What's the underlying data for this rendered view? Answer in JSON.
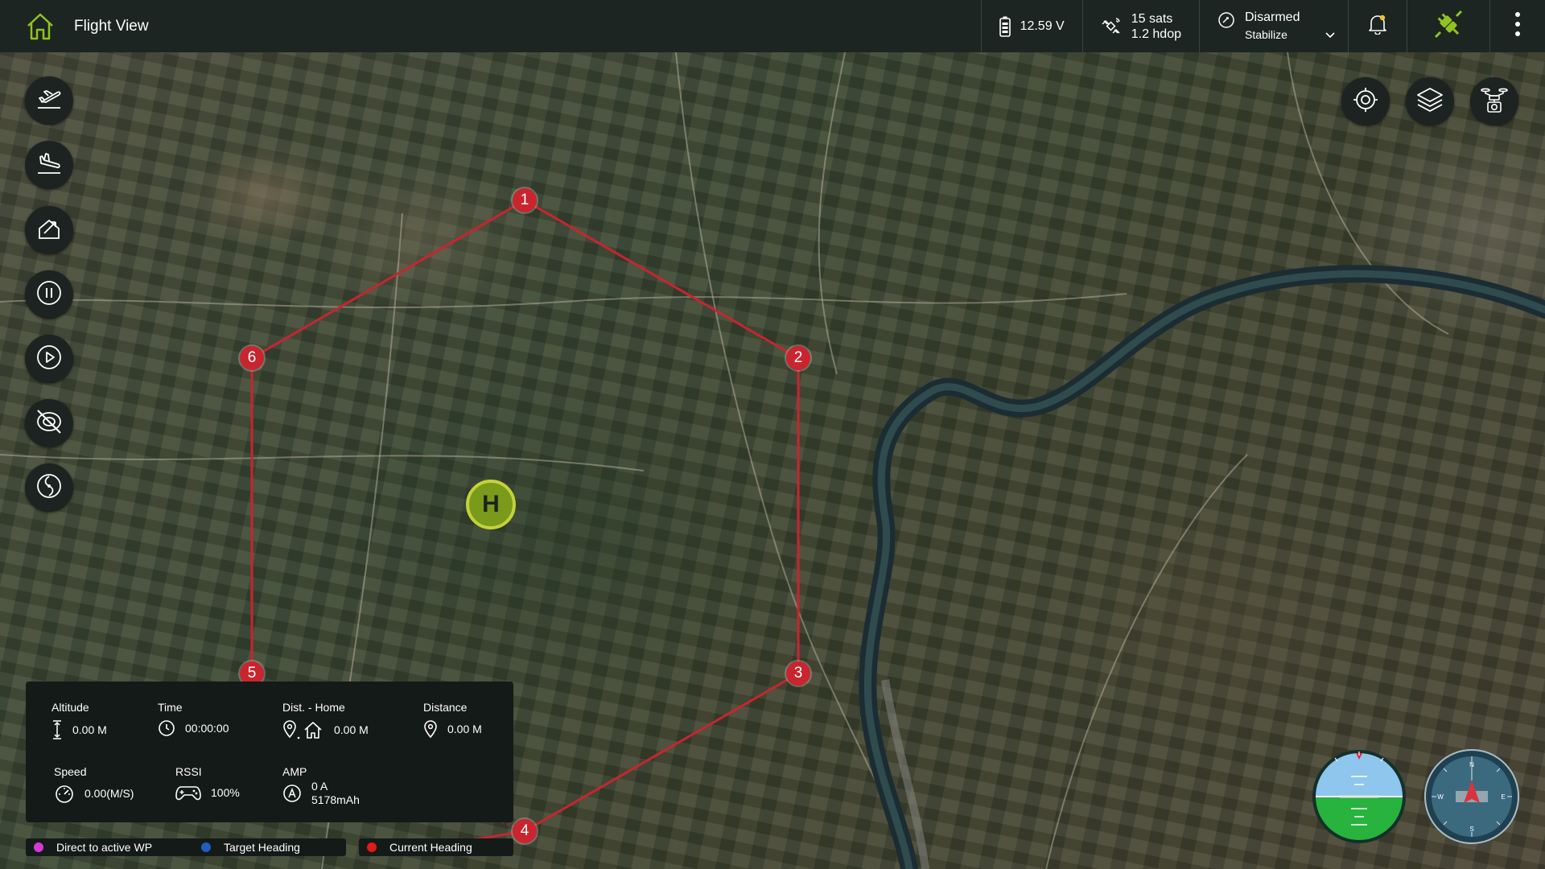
{
  "header": {
    "title": "Flight View",
    "battery": "12.59 V",
    "gps_sats": "15 sats",
    "gps_hdop": "1.2 hdop",
    "arm_status": "Disarmed",
    "flight_mode": "Stabilize"
  },
  "waypoints": [
    {
      "label": "1"
    },
    {
      "label": "2"
    },
    {
      "label": "3"
    },
    {
      "label": "4"
    },
    {
      "label": "5"
    },
    {
      "label": "6"
    }
  ],
  "home_marker": "H",
  "telemetry": {
    "altitude_label": "Altitude",
    "altitude_value": "0.00 M",
    "time_label": "Time",
    "time_value": "00:00:00",
    "dist_home_label": "Dist. - Home",
    "dist_home_value": "0.00 M",
    "distance_label": "Distance",
    "distance_value": "0.00 M",
    "speed_label": "Speed",
    "speed_value": "0.00(M/S)",
    "rssi_label": "RSSI",
    "rssi_value": "100%",
    "amp_label": "AMP",
    "amp_value": "0 A",
    "amp_capacity": "5178mAh"
  },
  "legend": [
    {
      "label": "Direct to active WP",
      "color": "#d63ad6"
    },
    {
      "label": "Target Heading",
      "color": "#1f5fbf"
    },
    {
      "label": "Current Heading",
      "color": "#e01b1b"
    }
  ],
  "compass": {
    "n": "N",
    "s": "S",
    "e": "E",
    "w": "W"
  },
  "colors": {
    "accent_green": "#8fc322",
    "waypoint_red": "#c8252f",
    "panel_bg": "#1c2320"
  },
  "icons": {
    "left_toolbar": [
      "takeoff-icon",
      "land-icon",
      "return-to-launch-icon",
      "pause-icon",
      "play-icon",
      "motor-off-icon",
      "propeller-icon"
    ],
    "right_toolbar": [
      "target-icon",
      "layers-icon",
      "drone-camera-icon"
    ]
  }
}
